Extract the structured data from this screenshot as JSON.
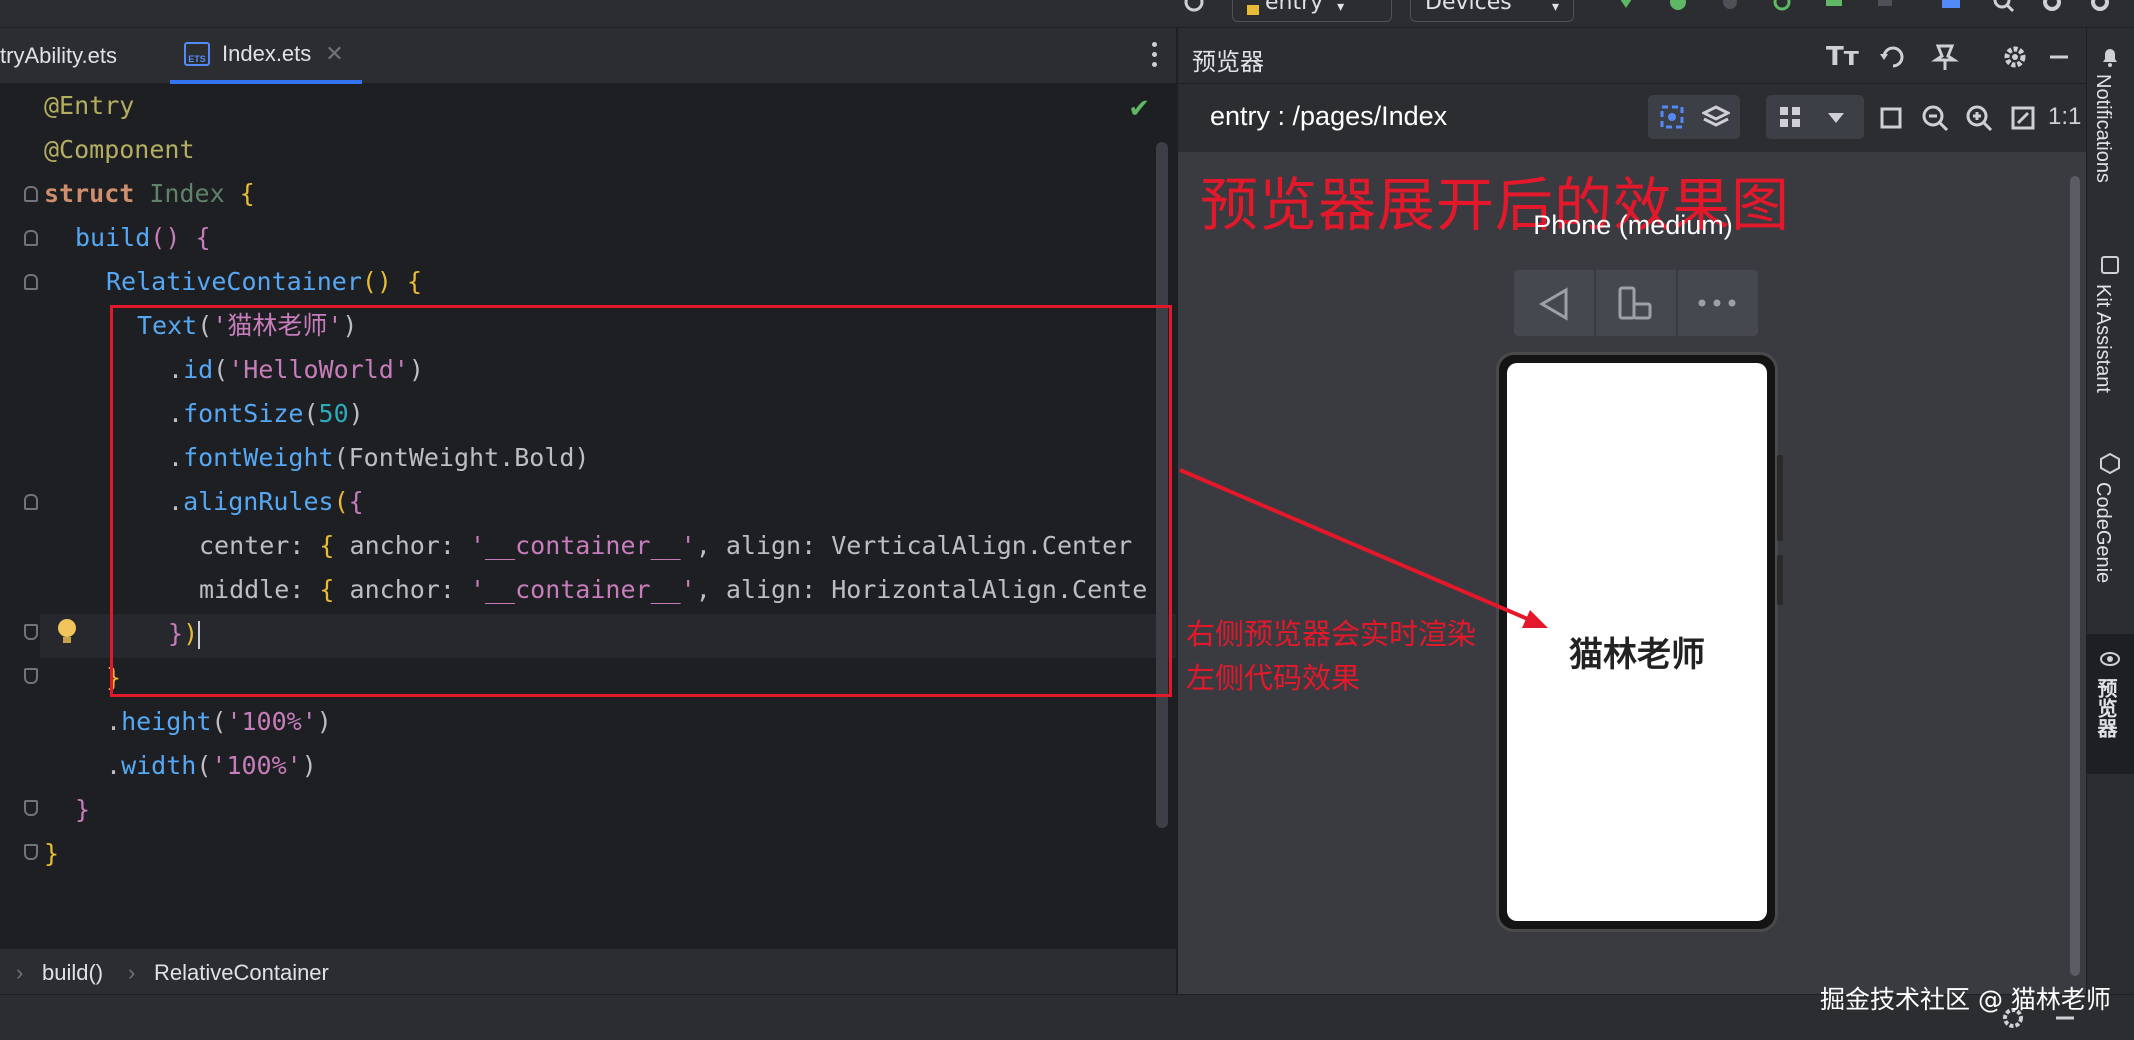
{
  "toolbar": {
    "run_config": "entry",
    "device_selector": "No Devices"
  },
  "editor_tabs": [
    {
      "label": "tryAbility.ets",
      "active": false
    },
    {
      "label": "Index.ets",
      "active": true
    }
  ],
  "code_lines": [
    "@Entry",
    "@Component",
    "struct Index {",
    "build() {",
    "RelativeContainer() {",
    "Text('猫林老师')",
    ".id('HelloWorld')",
    ".fontSize(50)",
    ".fontWeight(FontWeight.Bold)",
    ".alignRules({",
    "center: { anchor: '__container__', align: VerticalAlign.Center",
    "middle: { anchor: '__container__', align: HorizontalAlign.Cente",
    "})",
    "}",
    ".height('100%')",
    ".width('100%')",
    "}",
    "}"
  ],
  "breadcrumb": [
    "build()",
    "RelativeContainer"
  ],
  "preview": {
    "panel_title": "预览器",
    "route": "entry : /pages/Index",
    "zoom_label": "1:1",
    "device_name": "Phone (medium)",
    "screen_text": "猫林老师"
  },
  "annotations": {
    "heading": "预览器展开后的效果图",
    "arrow_note_line1": "右侧预览器会实时渲染",
    "arrow_note_line2": "左侧代码效果",
    "annotation_color": "#e3192b"
  },
  "right_strip": [
    "Notifications",
    "Kit Assistant",
    "CodeGenie",
    "预览器"
  ],
  "watermark": "掘金技术社区 @ 猫林老师",
  "icons": [
    "settings-icon",
    "search-icon",
    "run-icon",
    "debug-icon",
    "refresh-icon",
    "font-size-icon",
    "pin-icon",
    "minimize-icon",
    "inspector-icon",
    "layers-icon",
    "fit-icon",
    "zoom-out-icon",
    "zoom-in-icon",
    "bulb-icon",
    "check-icon"
  ]
}
